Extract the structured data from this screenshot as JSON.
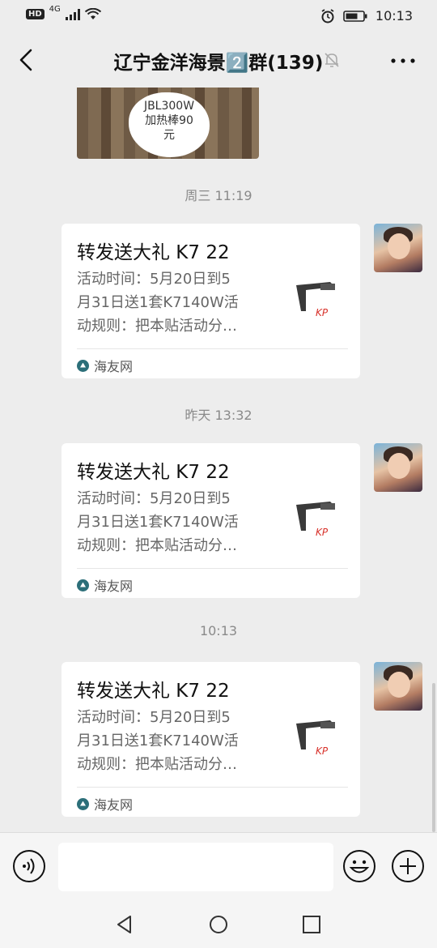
{
  "status": {
    "left_label": "HD",
    "network": "4G",
    "time": "10:13"
  },
  "header": {
    "title": "辽宁金洋海景2️⃣群(139)"
  },
  "image_message": {
    "sticker_text": [
      "JBL300W",
      "加热棒90",
      "元"
    ]
  },
  "messages": [
    {
      "timestamp": "周三 11:19",
      "title": "转发送大礼 K7 22",
      "desc": [
        "活动时间：5月20日到5",
        "月31日送1套K7140W活",
        "动规则：把本贴活动分…"
      ],
      "source": "海友网"
    },
    {
      "timestamp": "昨天 13:32",
      "title": "转发送大礼 K7 22",
      "desc": [
        "活动时间：5月20日到5",
        "月31日送1套K7140W活",
        "动规则：把本贴活动分…"
      ],
      "source": "海友网"
    },
    {
      "timestamp": "10:13",
      "title": "转发送大礼 K7 22",
      "desc": [
        "活动时间：5月20日到5",
        "月31日送1套K7140W活",
        "动规则：把本贴活动分…"
      ],
      "source": "海友网"
    }
  ],
  "colors": {
    "background": "#ededed",
    "card": "#ffffff",
    "accent_logo": "#2c6f79",
    "brand_red": "#d8322b"
  }
}
